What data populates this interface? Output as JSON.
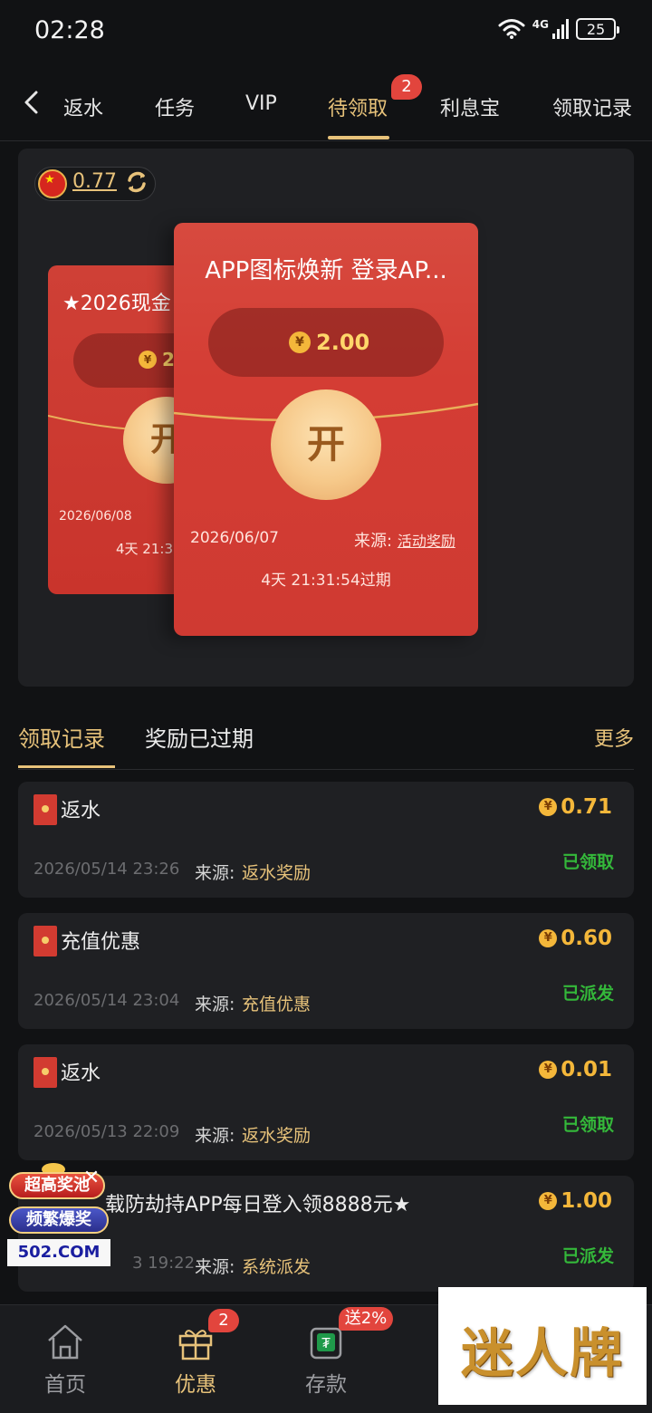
{
  "status_bar": {
    "time": "02:28",
    "network": "4G",
    "battery": "25"
  },
  "tabs": {
    "items": [
      {
        "label": "返水"
      },
      {
        "label": "任务"
      },
      {
        "label": "VIP"
      },
      {
        "label": "待领取",
        "badge": "2",
        "active": true
      },
      {
        "label": "利息宝"
      },
      {
        "label": "领取记录"
      }
    ]
  },
  "balance": {
    "value": "0.77"
  },
  "packets": {
    "back": {
      "title": "★2026现金",
      "amount": "2.",
      "open": "开",
      "date": "2026/06/08",
      "expiry": "4天 21:31"
    },
    "front": {
      "title": "APP图标焕新 登录AP...",
      "amount": "2.00",
      "open": "开",
      "date": "2026/06/07",
      "source_label": "来源:",
      "source_link": "活动奖励",
      "expiry": "4天 21:31:54过期"
    }
  },
  "records_header": {
    "tab_claimed": "领取记录",
    "tab_expired": "奖励已过期",
    "more": "更多"
  },
  "records": [
    {
      "name": "返水",
      "amount": "0.71",
      "status": "已领取",
      "date": "2026/05/14 23:26",
      "source_label": "来源:",
      "source": "返水奖励"
    },
    {
      "name": "充值优惠",
      "amount": "0.60",
      "status": "已派发",
      "date": "2026/05/14 23:04",
      "source_label": "来源:",
      "source": "充值优惠"
    },
    {
      "name": "返水",
      "amount": "0.01",
      "status": "已领取",
      "date": "2026/05/13 22:09",
      "source_label": "来源:",
      "source": "返水奖励"
    },
    {
      "name": "载防劫持APP每日登入领8888元★",
      "amount": "1.00",
      "status": "已派发",
      "date": "3 19:22",
      "source_label": "来源:",
      "source": "系统派发"
    }
  ],
  "ad": {
    "line1": "超高奖池",
    "line2": "频繁爆奖",
    "domain": "502.COM"
  },
  "bottom_nav": {
    "items": [
      {
        "label": "首页"
      },
      {
        "label": "优惠",
        "badge": "2",
        "active": true
      },
      {
        "label": "存款",
        "badge": "送2%"
      }
    ]
  },
  "watermark": {
    "text": "迷人牌"
  },
  "currency_symbol": "¥",
  "colors": {
    "accent": "#e7c27a",
    "success": "#34b83a",
    "packet_red": "#d43d34",
    "badge_red": "#e2453d"
  }
}
